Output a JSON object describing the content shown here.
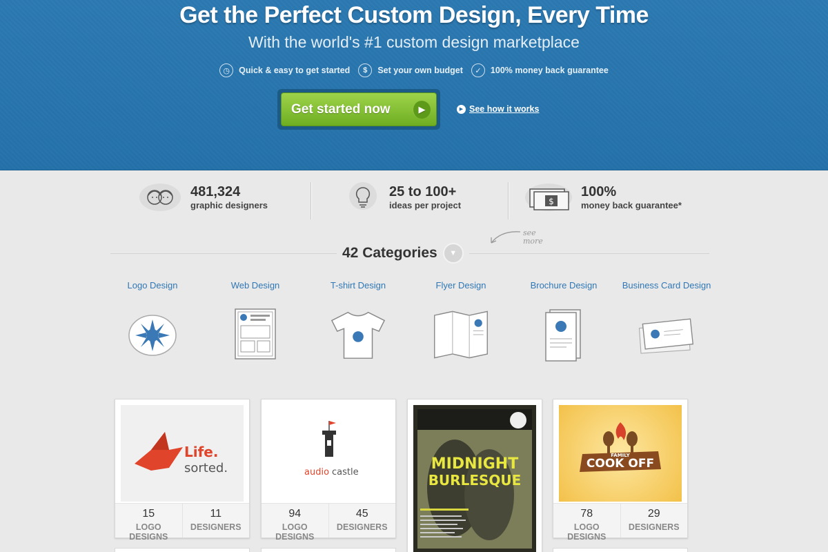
{
  "hero": {
    "title": "Get the Perfect Custom Design, Every Time",
    "subtitle": "With the world's #1 custom design marketplace",
    "features": [
      {
        "icon": "clock-icon",
        "label": "Quick & easy to get started"
      },
      {
        "icon": "dollar-icon",
        "label": "Set your own budget"
      },
      {
        "icon": "check-icon",
        "label": "100% money back guarantee"
      }
    ],
    "cta_label": "Get started now",
    "how_it_works": "See how it works"
  },
  "stats": [
    {
      "icon": "designers-icon",
      "value": "481,324",
      "label": "graphic designers"
    },
    {
      "icon": "lightbulb-icon",
      "value": "25 to 100+",
      "label": "ideas per project"
    },
    {
      "icon": "money-icon",
      "value": "100%",
      "label": "money back guarantee*"
    }
  ],
  "categories": {
    "heading": "42 Categories",
    "see_more": "see more",
    "items": [
      {
        "label": "Logo Design",
        "icon": "logo-design-icon"
      },
      {
        "label": "Web Design",
        "icon": "web-design-icon"
      },
      {
        "label": "T-shirt Design",
        "icon": "tshirt-icon"
      },
      {
        "label": "Flyer Design",
        "icon": "flyer-icon"
      },
      {
        "label": "Brochure Design",
        "icon": "brochure-icon"
      },
      {
        "label": "Business Card Design",
        "icon": "business-card-icon"
      }
    ]
  },
  "cards": [
    {
      "image": "life-sorted-logo",
      "brand_line1": "Life.",
      "brand_line2": "sorted.",
      "count1": "15",
      "label1": "LOGO DESIGNS",
      "count2": "11",
      "label2": "DESIGNERS"
    },
    {
      "image": "audiocastle-logo",
      "brand_line1": "audio",
      "brand_line2": "castle",
      "count1": "94",
      "label1": "LOGO DESIGNS",
      "count2": "45",
      "label2": "DESIGNERS"
    },
    {
      "image": "midnight-burlesque-poster",
      "brand_line1": "MIDNIGHT",
      "brand_line2": "BURLESQUE"
    },
    {
      "image": "family-cook-off-logo",
      "brand_line1": "FAMILY",
      "brand_line2": "COOK OFF",
      "count1": "78",
      "label1": "LOGO DESIGNS",
      "count2": "29",
      "label2": "DESIGNERS"
    }
  ],
  "colors": {
    "hero_blue": "#2470a9",
    "cta_green": "#7dbb2e",
    "link_blue": "#2f77b5"
  }
}
